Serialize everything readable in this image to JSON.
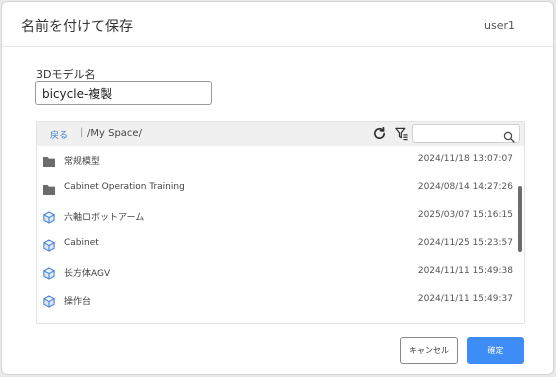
{
  "dialog": {
    "title": "名前を付けて保存",
    "user": "user1"
  },
  "form": {
    "name_label": "3Dモデル名",
    "name_value": "bicycle-複製"
  },
  "browser": {
    "back_label": "戻る",
    "separator": "|",
    "path": "/My Space/",
    "search_placeholder": "",
    "icons": {
      "refresh": "refresh-icon",
      "filter": "filter-icon",
      "search": "search-icon"
    },
    "items": [
      {
        "type": "folder",
        "icon": "folder-icon",
        "name": "常规模型",
        "date": "2024/11/18 13:07:07"
      },
      {
        "type": "folder",
        "icon": "folder-icon",
        "name": "Cabinet Operation Training",
        "date": "2024/08/14 14:27:26"
      },
      {
        "type": "model",
        "icon": "cube-icon",
        "name": "六軸ロボットアーム",
        "date": "2025/03/07 15:16:15"
      },
      {
        "type": "model",
        "icon": "cube-icon",
        "name": "Cabinet",
        "date": "2024/11/25 15:23:57"
      },
      {
        "type": "model",
        "icon": "cube-icon",
        "name": "长方体AGV",
        "date": "2024/11/11 15:49:38"
      },
      {
        "type": "model",
        "icon": "cube-icon",
        "name": "操作台",
        "date": "2024/11/11 15:49:37"
      }
    ]
  },
  "footer": {
    "cancel_label": "キャンセル",
    "ok_label": "確定"
  },
  "colors": {
    "accent": "#3e8cf5",
    "link": "#3a7bd5",
    "model_icon": "#4a86d8",
    "folder_icon": "#6b6b6b"
  }
}
